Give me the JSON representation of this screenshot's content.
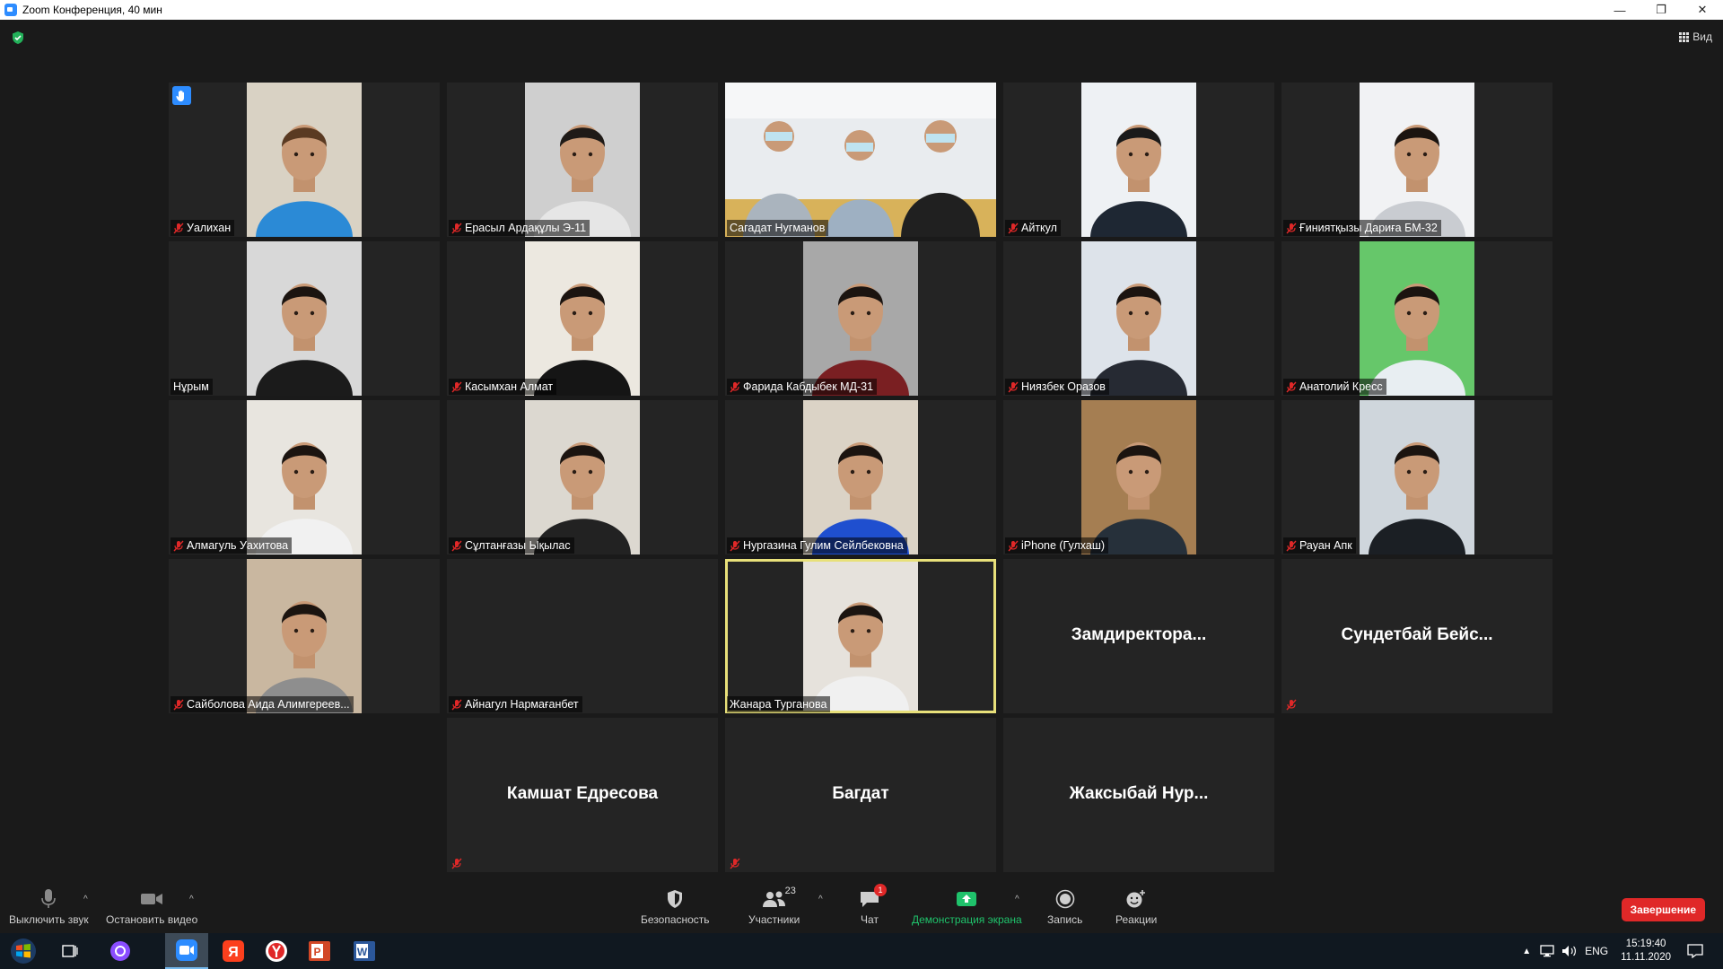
{
  "window": {
    "title": "Zoom Конференция, 40 мин",
    "minimize": "—",
    "maximize": "❐",
    "close": "✕"
  },
  "meeting": {
    "view_label": "Вид",
    "participants": [
      {
        "name": "Уалихан",
        "muted": true,
        "hand_raised": true
      },
      {
        "name": "Ерасыл Ардақұлы Э-11",
        "muted": true
      },
      {
        "name": "Сагадат Нугманов",
        "muted": false
      },
      {
        "name": "Айткул",
        "muted": true
      },
      {
        "name": "Ғиниятқызы Дариға БМ-32",
        "muted": true
      },
      {
        "name": "Нұрым",
        "muted": false
      },
      {
        "name": "Касымхан Алмат",
        "muted": true
      },
      {
        "name": "Фарида Кабдыбек МД-31",
        "muted": true
      },
      {
        "name": "Ниязбек Оразов",
        "muted": true
      },
      {
        "name": "Анатолий Кресс",
        "muted": true
      },
      {
        "name": "Алмагуль Уахитова",
        "muted": true
      },
      {
        "name": "Сұлтанғазы Ықылас",
        "muted": true
      },
      {
        "name": "Нургазина Гулим Сейлбековна",
        "muted": true
      },
      {
        "name": "iPhone (Гулхаш)",
        "muted": true
      },
      {
        "name": "Рауан Апк",
        "muted": true
      },
      {
        "name": "Сайболова Аида Алимгереев...",
        "muted": true
      },
      {
        "name": "Айнагул Нармағанбет",
        "muted": true
      },
      {
        "name": "Жанара Турганова",
        "muted": false,
        "active_speaker": true
      },
      {
        "name": "Замдиректора...",
        "muted": false,
        "video": false
      },
      {
        "name": "Сундетбай Бейс...",
        "muted": true,
        "video": false
      },
      {
        "name": "Камшат Едресова",
        "muted": true,
        "video": false
      },
      {
        "name": "Багдат",
        "muted": true,
        "video": false
      },
      {
        "name": "Жаксыбай Нур...",
        "muted": false,
        "video": false
      }
    ]
  },
  "toolbar": {
    "mute_label": "Выключить звук",
    "video_label": "Остановить видео",
    "security_label": "Безопасность",
    "participants_label": "Участники",
    "participants_count": "23",
    "chat_label": "Чат",
    "chat_badge": "1",
    "share_label": "Демонстрация экрана",
    "record_label": "Запись",
    "reactions_label": "Реакции",
    "end_label": "Завершение",
    "caret": "^"
  },
  "taskbar": {
    "language": "ENG",
    "time": "15:19:40",
    "date": "11.11.2020"
  },
  "colors": {
    "accent": "#2d8cff",
    "end_red": "#e02828",
    "active_border": "#e8e07a",
    "share_green": "#1fc26b"
  }
}
